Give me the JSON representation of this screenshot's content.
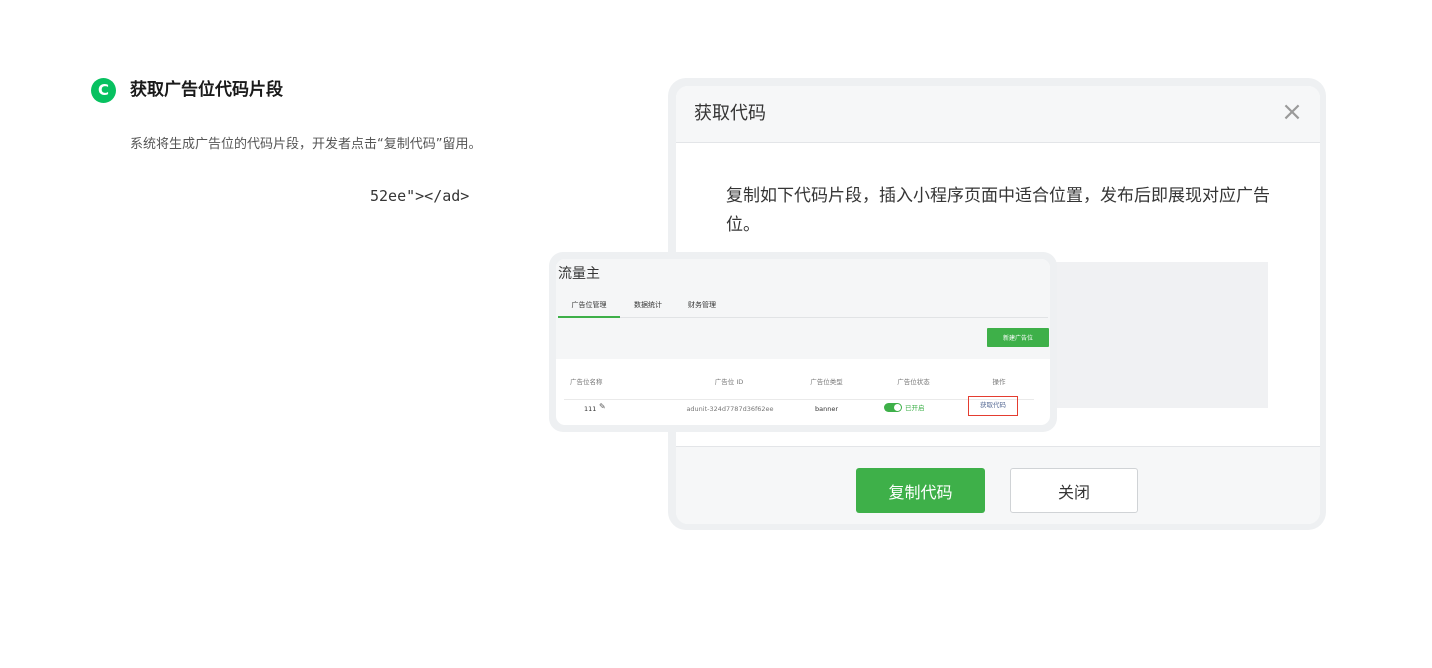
{
  "step": {
    "badge": "C",
    "title": "获取广告位代码片段",
    "description": "系统将生成广告位的代码片段，开发者点击“复制代码”留用。"
  },
  "dialog": {
    "title": "获取代码",
    "close_icon": "×",
    "instruction": "复制如下代码片段，插入小程序页面中适合位置，发布后即展现对应广告位。",
    "code_visible": "52ee\"></ad>",
    "copy_button": "复制代码",
    "close_button": "关闭"
  },
  "card": {
    "title": "流量主",
    "tabs": [
      {
        "label": "广告位管理",
        "active": true
      },
      {
        "label": "数据统计",
        "active": false
      },
      {
        "label": "财务管理",
        "active": false
      }
    ],
    "new_button": "新建广告位",
    "columns": [
      "广告位名称",
      "广告位 ID",
      "广告位类型",
      "广告位状态",
      "操作"
    ],
    "row": {
      "name": "111",
      "id": "adunit-324d7787d36f62ee",
      "type": "banner",
      "status": "已开启",
      "status_on": true,
      "action": "获取代码"
    }
  },
  "colors": {
    "accent_green": "#3eb049",
    "badge_green": "#07c160",
    "highlight_red": "#e43d30",
    "link_blue": "#576b95"
  }
}
